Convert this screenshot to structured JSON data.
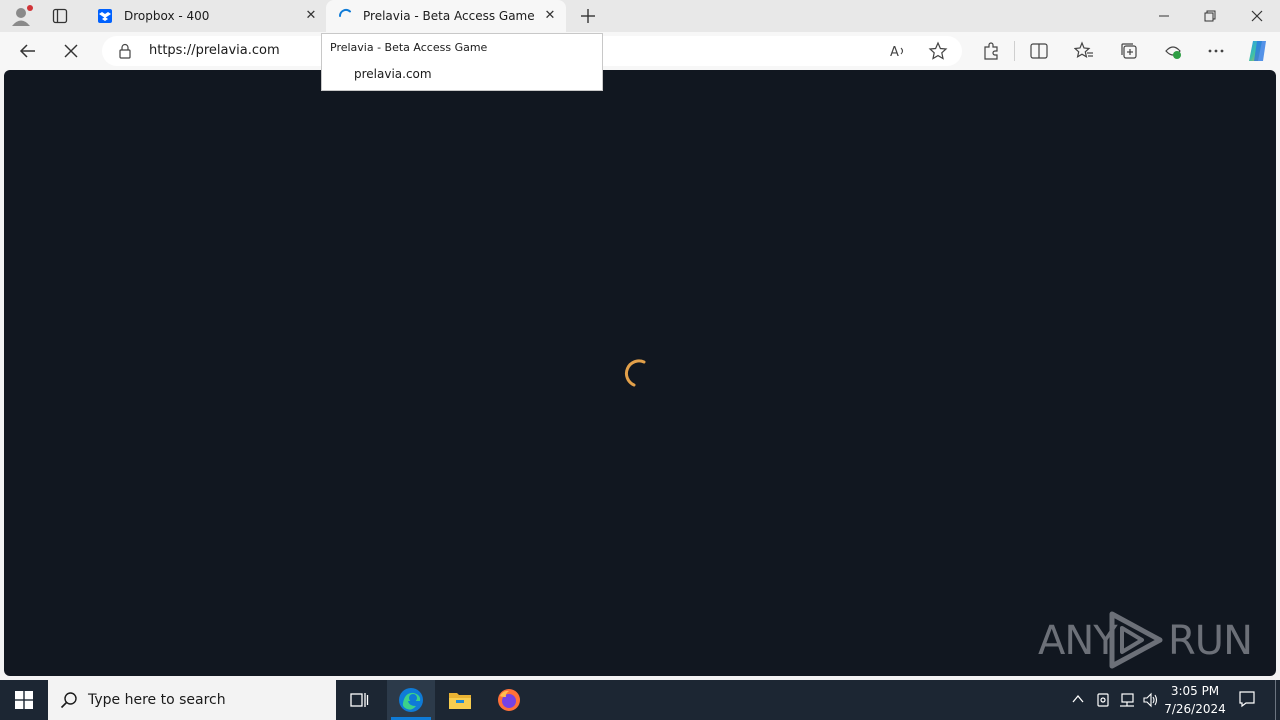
{
  "browser": {
    "tabs": [
      {
        "title": "Dropbox - 400"
      },
      {
        "title": "Prelavia - Beta Access Game"
      }
    ],
    "address_bar": {
      "url": "https://prelavia.com"
    },
    "tooltip": {
      "title": "Prelavia - Beta Access Game",
      "url": "prelavia.com"
    }
  },
  "page": {
    "background_color": "#111720",
    "spinner_color": "#e2a04a",
    "watermark": "ANY RUN"
  },
  "taskbar": {
    "search_placeholder": "Type here to search",
    "time": "3:05 PM",
    "date": "7/26/2024"
  },
  "colors": {
    "dropbox_blue": "#0061fe",
    "edge_accent": "#0f7bd7",
    "taskbar": "#1c2633"
  }
}
